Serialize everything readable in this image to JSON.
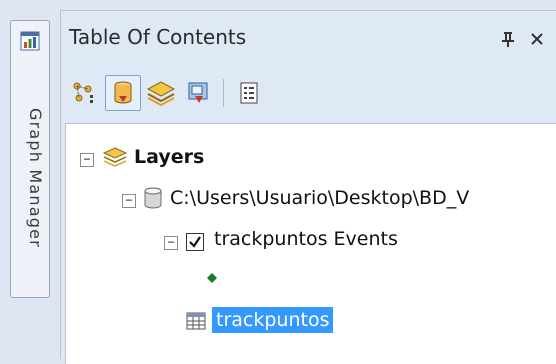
{
  "side_dock": {
    "tab_label": "Graph Manager",
    "tab_icon": "graph-icon"
  },
  "toc": {
    "title": "Table Of Contents",
    "pin_icon": "pin-icon",
    "close_icon": "close-icon",
    "toolbar": [
      {
        "name": "list-by-drawing-order",
        "icon": "list-drawing-order-icon",
        "active": false
      },
      {
        "name": "list-by-source",
        "icon": "database-source-icon",
        "active": true
      },
      {
        "name": "list-by-visibility",
        "icon": "layers-visibility-icon",
        "active": false
      },
      {
        "name": "list-by-selection",
        "icon": "selection-icon",
        "active": false
      },
      {
        "name": "options",
        "icon": "options-list-icon",
        "active": false
      }
    ],
    "tree": {
      "layers_label": "Layers",
      "workspace_path": "C:\\Users\\Usuario\\Desktop\\BD_V",
      "events_label": "trackpuntos Events",
      "events_checked": true,
      "table_label": "trackpuntos"
    },
    "colors": {
      "selection": "#3399ff",
      "symbol": "#1b7a2b"
    }
  }
}
